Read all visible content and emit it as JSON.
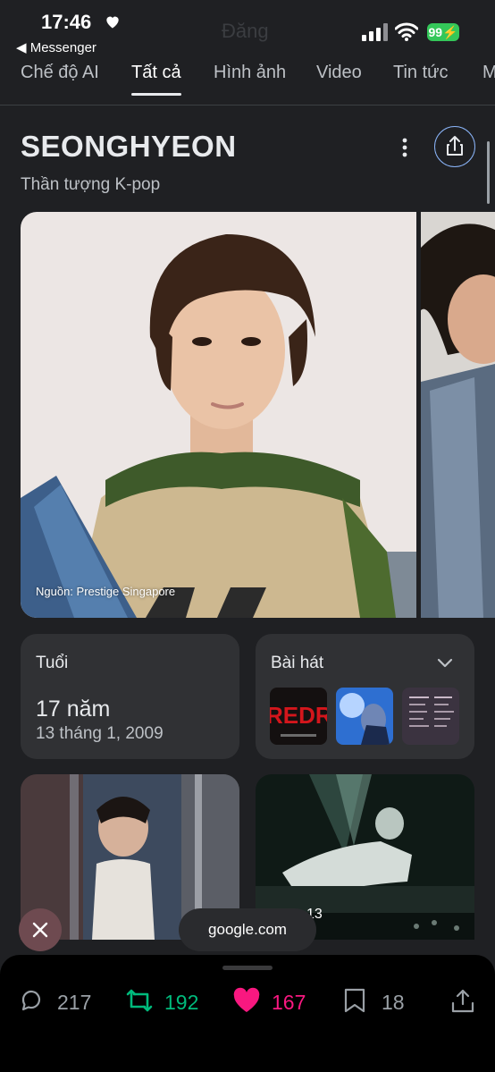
{
  "status": {
    "time": "17:46",
    "back_app": "◀ Messenger",
    "faded_title": "Đăng",
    "battery": "99"
  },
  "tabs": [
    "Chế độ AI",
    "Tất cả",
    "Hình ảnh",
    "Video",
    "Tin tức",
    "M"
  ],
  "active_tab": "Tất cả",
  "entity": {
    "name": "SEONGHYEON",
    "description": "Thần tượng K-pop",
    "image_caption": "Nguồn: Prestige Singapore"
  },
  "age_card": {
    "label": "Tuổi",
    "value": "17 năm",
    "date": "13 tháng 1, 2009"
  },
  "songs_card": {
    "label": "Bài hát",
    "albums": [
      "REDRED",
      "photo",
      "tracklist"
    ]
  },
  "video_tile": {
    "overlay": "13"
  },
  "url_pill": "google.com",
  "bottom_bar": {
    "replies": "217",
    "reposts": "192",
    "likes": "167",
    "bookmarks": "18"
  },
  "colors": {
    "background": "#1f2023",
    "card": "#303134",
    "accent_blue": "#8ab4f8",
    "repost_green": "#00ba7c",
    "like_pink": "#f91880",
    "battery_green": "#34c759"
  }
}
